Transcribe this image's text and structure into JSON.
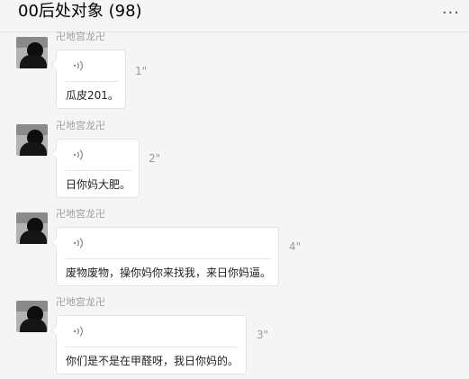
{
  "header": {
    "title": "00后处对象 (98)",
    "more_icon": "more-dots-icon"
  },
  "messages": [
    {
      "sender": "卍地宫龙卍",
      "duration": "1\"",
      "transcript": "瓜皮201。"
    },
    {
      "sender": "卍地宫龙卍",
      "duration": "2\"",
      "transcript": "日你妈大肥。"
    },
    {
      "sender": "卍地宫龙卍",
      "duration": "4\"",
      "transcript": "废物废物，操你妈你来找我，来日你妈逼。"
    },
    {
      "sender": "卍地宫龙卍",
      "duration": "3\"",
      "transcript": "你们是不是在甲醛呀，我日你妈的。"
    }
  ],
  "colors": {
    "background": "#f5f5f5",
    "bubble": "#ffffff",
    "muted_text": "#a0a0a0"
  }
}
